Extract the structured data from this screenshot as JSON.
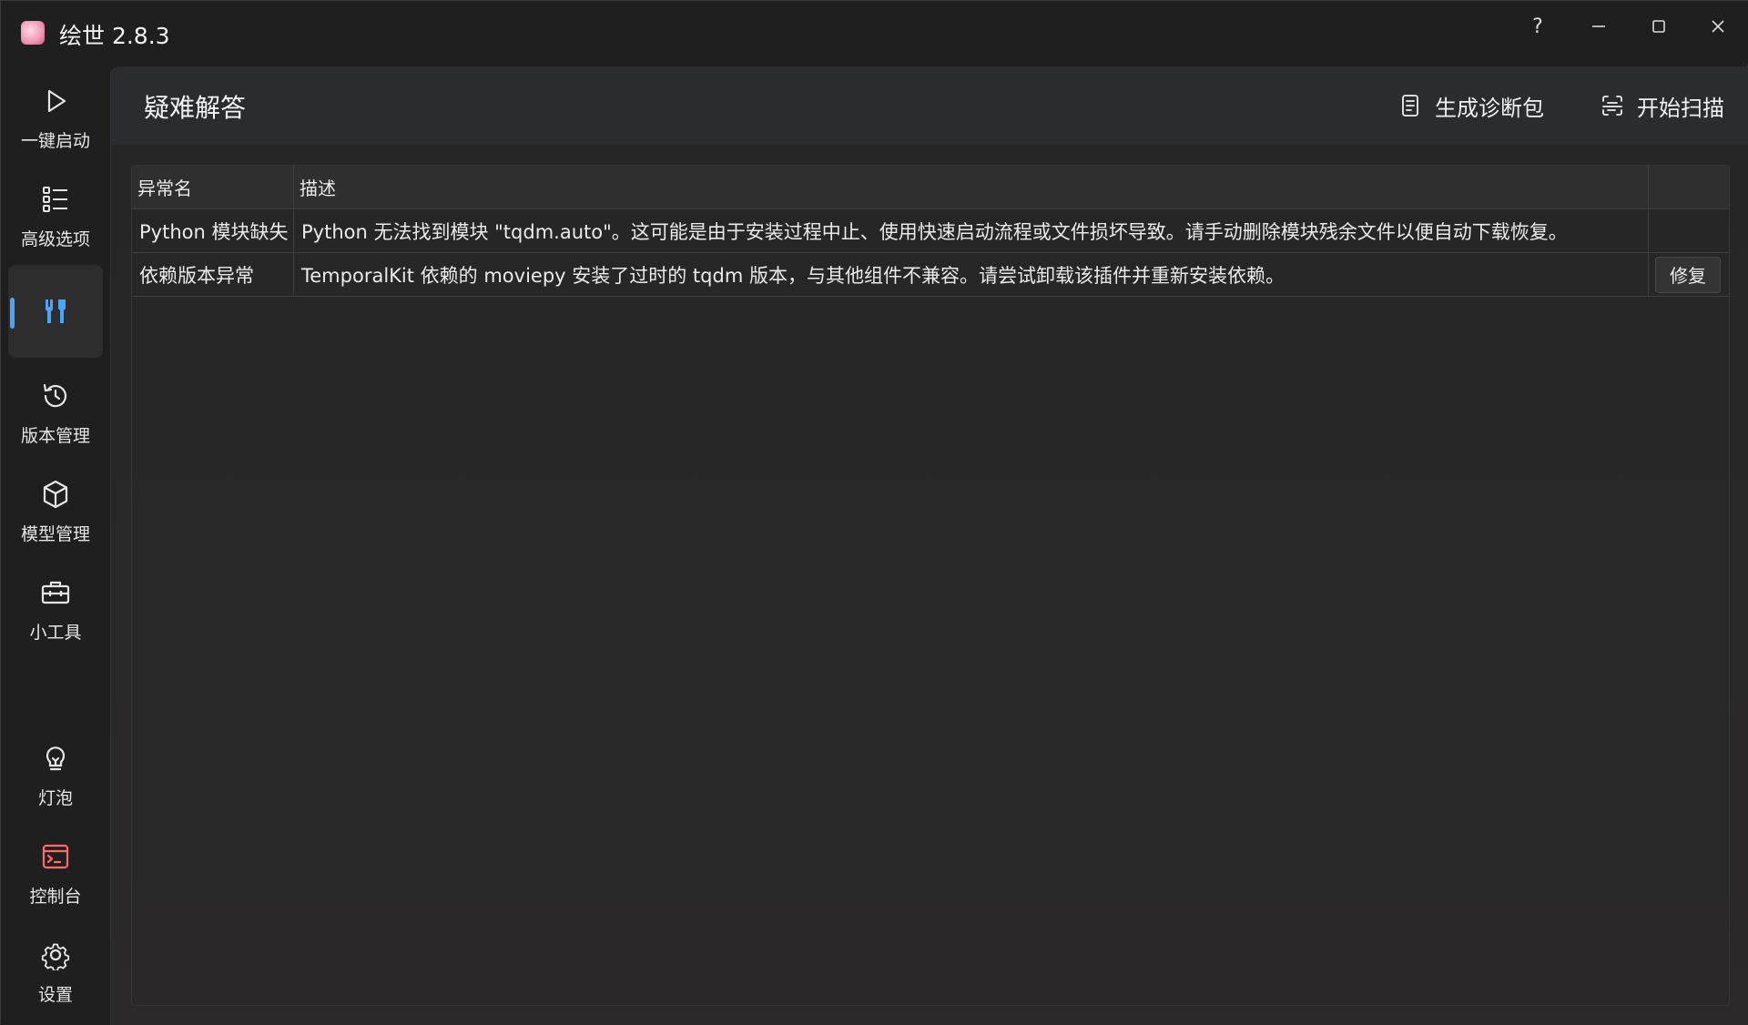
{
  "window": {
    "title": "绘世 2.8.3",
    "controls": {
      "help": "?",
      "minimize": "—",
      "maximize": "☐",
      "close": "✕"
    }
  },
  "sidebar": {
    "items": [
      {
        "label": "一键启动",
        "icon": "play-icon"
      },
      {
        "label": "高级选项",
        "icon": "list-icon"
      },
      {
        "label": "",
        "icon": "tools-icon",
        "active": true
      },
      {
        "label": "版本管理",
        "icon": "history-icon"
      },
      {
        "label": "模型管理",
        "icon": "cube-icon"
      },
      {
        "label": "小工具",
        "icon": "toolbox-icon"
      },
      {
        "label": "灯泡",
        "icon": "lightbulb-icon"
      },
      {
        "label": "控制台",
        "icon": "console-icon"
      },
      {
        "label": "设置",
        "icon": "gear-icon"
      }
    ],
    "accent_color": "#4aa3ff",
    "console_color": "#ff6b6b"
  },
  "page": {
    "title": "疑难解答",
    "actions": {
      "diagnose_label": "生成诊断包",
      "scan_label": "开始扫描"
    }
  },
  "table": {
    "columns": [
      "异常名",
      "描述",
      ""
    ],
    "rows": [
      {
        "name": "Python 模块缺失",
        "description": "Python 无法找到模块 \"tqdm.auto\"。这可能是由于安装过程中止、使用快速启动流程或文件损坏导致。请手动删除模块残余文件以便自动下载恢复。",
        "action": ""
      },
      {
        "name": "依赖版本异常",
        "description": "TemporalKit 依赖的 moviepy 安装了过时的 tqdm 版本，与其他组件不兼容。请尝试卸载该插件并重新安装依赖。",
        "action": "修复"
      }
    ]
  }
}
